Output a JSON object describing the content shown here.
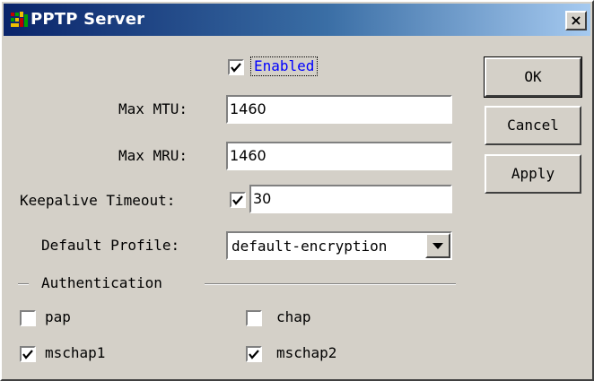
{
  "window": {
    "title": "PPTP Server",
    "close_glyph": "×"
  },
  "enabled": {
    "label": "Enabled",
    "checked": true
  },
  "fields": {
    "max_mtu_label": "Max MTU:",
    "max_mtu_value": "1460",
    "max_mru_label": "Max MRU:",
    "max_mru_value": "1460",
    "keepalive_label": "Keepalive Timeout:",
    "keepalive_checked": true,
    "keepalive_value": "30",
    "default_profile_label": "Default Profile:",
    "default_profile_value": "default-encryption"
  },
  "buttons": {
    "ok": "OK",
    "cancel": "Cancel",
    "apply": "Apply"
  },
  "authentication": {
    "group_label": "Authentication",
    "options": [
      {
        "label": "pap",
        "checked": false
      },
      {
        "label": "chap",
        "checked": false
      },
      {
        "label": "mschap1",
        "checked": true
      },
      {
        "label": "mschap2",
        "checked": true
      }
    ]
  },
  "colors": {
    "title_gradient_start": "#0a246a",
    "title_gradient_end": "#a6caf0",
    "dialog_face": "#d4d0c8",
    "focus_label": "#0000ff"
  }
}
